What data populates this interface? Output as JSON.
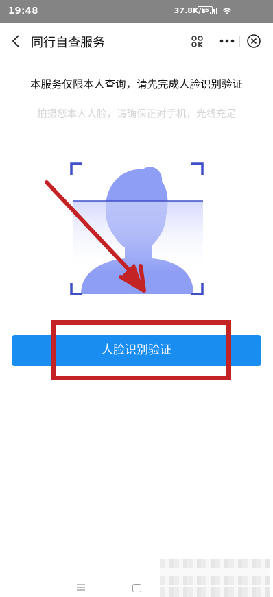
{
  "status_bar": {
    "time": "19:48",
    "network_speed": "37.8K/s",
    "battery_level": "66"
  },
  "nav": {
    "title": "同行自查服务",
    "icons": [
      "back-arrow-icon",
      "scan-icon",
      "more-dots-icon",
      "close-circle-icon"
    ]
  },
  "main": {
    "heading": "本服务仅限本人查询，请先完成人脸识别验证",
    "subtext": "拍摄您本人人脸，请确保正对手机，光线充足",
    "verify_button": "人脸识别验证"
  },
  "colors": {
    "primary": "#1a8df0",
    "face_silhouette": "#8f9ef5",
    "frame_corner": "#3f4fc9",
    "annotation_red": "#c42326"
  },
  "bottom_nav": {
    "icons": [
      "menu-icon",
      "home-icon"
    ]
  }
}
